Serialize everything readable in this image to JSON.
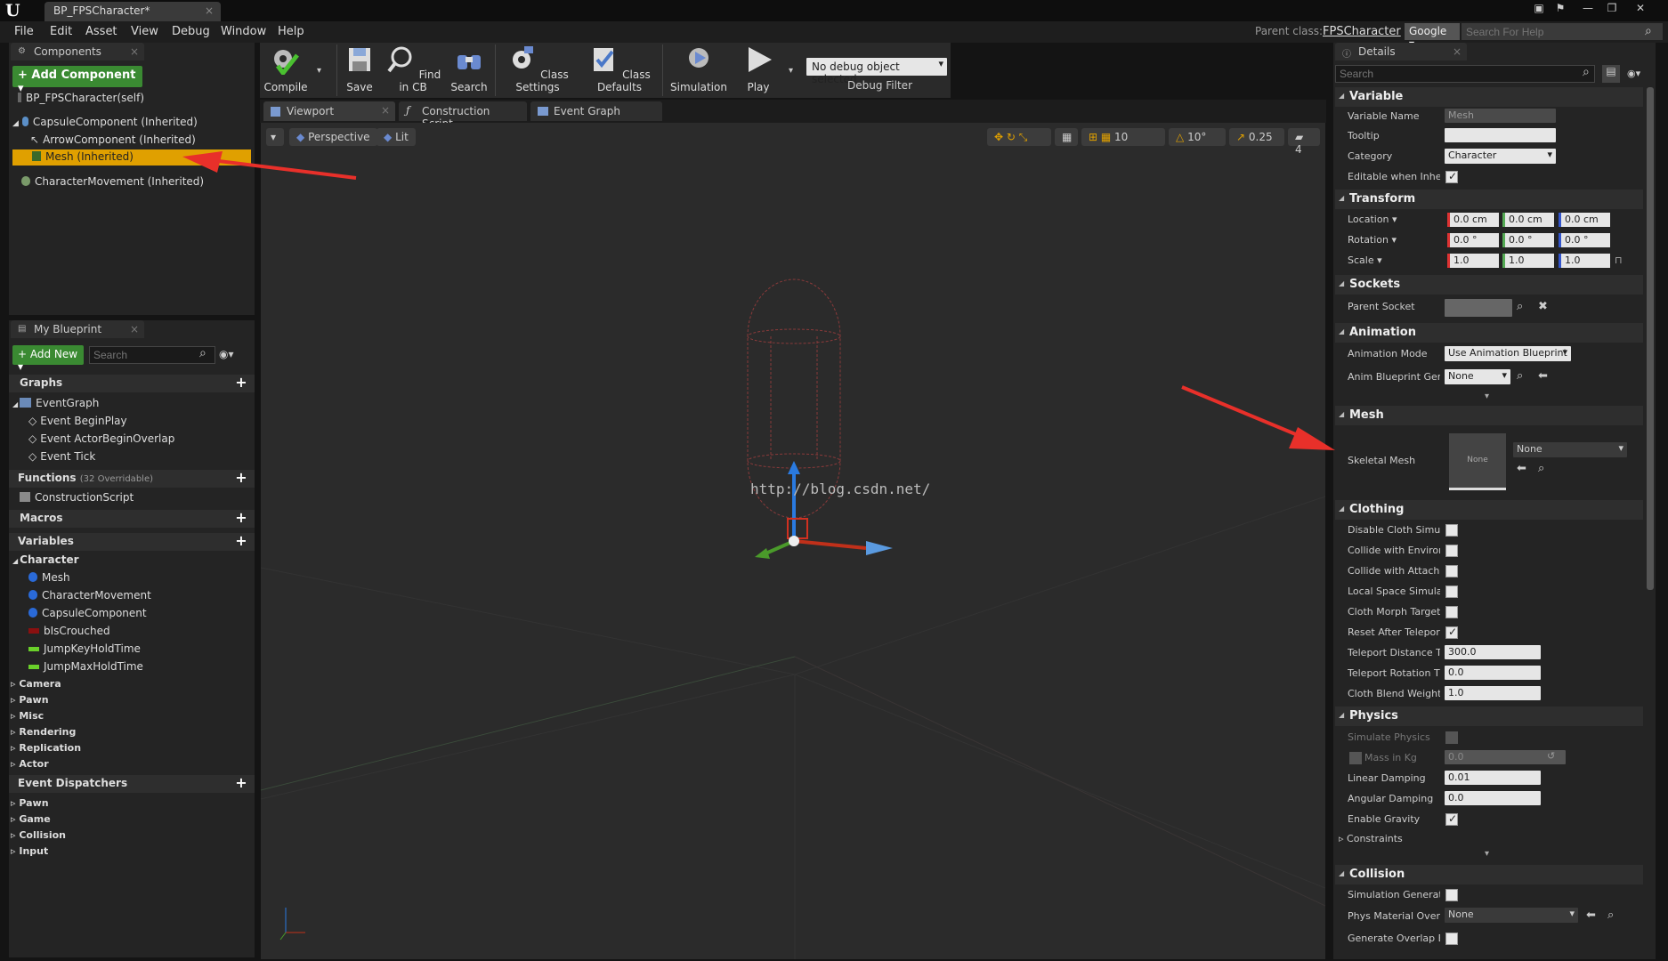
{
  "window": {
    "tab_title": "BP_FPSCharacter*"
  },
  "menu": [
    "File",
    "Edit",
    "Asset",
    "View",
    "Debug",
    "Window",
    "Help"
  ],
  "header": {
    "parent_class_label": "Parent class:",
    "parent_class_value": "FPSCharacter",
    "search_engine": "Google",
    "help_placeholder": "Search For Help"
  },
  "components": {
    "tab": "Components",
    "add_button": "Add Component",
    "self": "BP_FPSCharacter(self)",
    "items": [
      "CapsuleComponent (Inherited)",
      "ArrowComponent (Inherited)",
      "Mesh (Inherited)",
      "CharacterMovement (Inherited)"
    ]
  },
  "toolbar": {
    "buttons": [
      "Compile",
      "Save",
      "Find in CB",
      "Search",
      "Class Settings",
      "Class Defaults",
      "Simulation",
      "Play"
    ],
    "debug_select": "No debug object selected",
    "debug_label": "Debug Filter"
  },
  "editor_tabs": [
    "Viewport",
    "Construction Script",
    "Event Graph"
  ],
  "viewport": {
    "perspective": "Perspective",
    "lit": "Lit",
    "grid_snap": "10",
    "rot_snap": "10°",
    "scale_snap": "0.25",
    "camera_speed": "4",
    "watermark": "http://blog.csdn.net/"
  },
  "my_blueprint": {
    "tab": "My Blueprint",
    "add_new": "Add New",
    "search_placeholder": "Search",
    "graphs_label": "Graphs",
    "event_graph": "EventGraph",
    "events": [
      "Event BeginPlay",
      "Event ActorBeginOverlap",
      "Event Tick"
    ],
    "functions_label": "Functions",
    "functions_count": "(32 Overridable)",
    "construction": "ConstructionScript",
    "macros_label": "Macros",
    "variables_label": "Variables",
    "character_group": "Character",
    "variables": [
      "Mesh",
      "CharacterMovement",
      "CapsuleComponent",
      "bIsCrouched",
      "JumpKeyHoldTime",
      "JumpMaxHoldTime"
    ],
    "var_groups": [
      "Camera",
      "Pawn",
      "Misc",
      "Rendering",
      "Replication",
      "Actor"
    ],
    "dispatchers_label": "Event Dispatchers",
    "dispatcher_groups": [
      "Pawn",
      "Game",
      "Collision",
      "Input"
    ]
  },
  "details": {
    "tab": "Details",
    "search_placeholder": "Search",
    "variable": {
      "head": "Variable",
      "name_label": "Variable Name",
      "name_value": "Mesh",
      "tooltip_label": "Tooltip",
      "category_label": "Category",
      "category_value": "Character",
      "editable_label": "Editable when Inherit"
    },
    "transform": {
      "head": "Transform",
      "location_label": "Location",
      "rotation_label": "Rotation",
      "scale_label": "Scale",
      "location": [
        "0.0 cm",
        "0.0 cm",
        "0.0 cm"
      ],
      "rotation": [
        "0.0 °",
        "0.0 °",
        "0.0 °"
      ],
      "scale": [
        "1.0",
        "1.0",
        "1.0"
      ]
    },
    "sockets": {
      "head": "Sockets",
      "parent_label": "Parent Socket"
    },
    "animation": {
      "head": "Animation",
      "mode_label": "Animation Mode",
      "mode_value": "Use Animation Blueprint",
      "bp_label": "Anim Blueprint Gene",
      "bp_value": "None"
    },
    "mesh": {
      "head": "Mesh",
      "label": "Skeletal Mesh",
      "thumb": "None",
      "value": "None"
    },
    "clothing": {
      "head": "Clothing",
      "rows": [
        "Disable Cloth Simula",
        "Collide with Environ",
        "Collide with Attache",
        "Local Space Simulat",
        "Cloth Morph Target",
        "Reset After Teleport"
      ],
      "teleport_dist_label": "Teleport Distance Th",
      "teleport_dist": "300.0",
      "teleport_rot_label": "Teleport Rotation Th",
      "teleport_rot": "0.0",
      "blend_label": "Cloth Blend Weight",
      "blend": "1.0"
    },
    "physics": {
      "head": "Physics",
      "simulate_label": "Simulate Physics",
      "mass_label": "Mass in Kg",
      "mass": "0.0",
      "linear_label": "Linear Damping",
      "linear": "0.01",
      "angular_label": "Angular Damping",
      "angular": "0.0",
      "gravity_label": "Enable Gravity",
      "constraints_label": "Constraints"
    },
    "collision": {
      "head": "Collision",
      "sim_gen_label": "Simulation Generate",
      "phys_mat_label": "Phys Material Overri",
      "phys_mat": "None",
      "overlap_label": "Generate Overlap Ev"
    }
  },
  "colors": {
    "selection": "#e0a000",
    "green_button": "#3a8a32",
    "arrow": "#e8302a"
  }
}
